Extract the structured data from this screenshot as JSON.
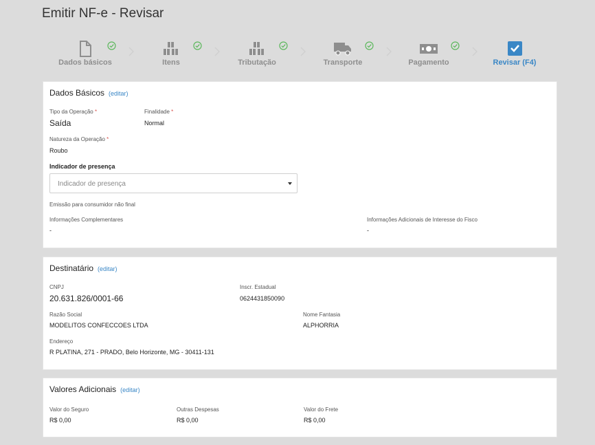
{
  "page": {
    "title": "Emitir NF-e - Revisar"
  },
  "stepper": {
    "steps": [
      {
        "label": "Dados básicos",
        "icon": "document-icon",
        "done": true
      },
      {
        "label": "Itens",
        "icon": "boxes-icon",
        "done": true
      },
      {
        "label": "Tributação",
        "icon": "boxes-icon",
        "done": true
      },
      {
        "label": "Transporte",
        "icon": "truck-icon",
        "done": true
      },
      {
        "label": "Pagamento",
        "icon": "banknote-icon",
        "done": true
      },
      {
        "label": "Revisar (F4)",
        "icon": "checkbox-icon",
        "done": false,
        "active": true
      }
    ],
    "colors": {
      "done_check": "#5cb85c",
      "active": "#3a87c6",
      "inactive": "#8e8e8e"
    }
  },
  "dados_basicos": {
    "title": "Dados Básicos",
    "edit": "(editar)",
    "tipo_operacao": {
      "label": "Tipo da Operação",
      "value": "Saída"
    },
    "finalidade": {
      "label": "Finalidade",
      "value": "Normal"
    },
    "natureza_operacao": {
      "label": "Natureza da Operação",
      "value": "Roubo"
    },
    "indicador_presenca": {
      "label": "Indicador de presença",
      "placeholder": "Indicador de presença"
    },
    "consumidor": "Emissão para consumidor não final",
    "info_complementares": {
      "label": "Informações Complementares",
      "value": "-"
    },
    "info_fisco": {
      "label": "Informações Adicionais de Interesse do Fisco",
      "value": "-"
    }
  },
  "destinatario": {
    "title": "Destinatário",
    "edit": "(editar)",
    "cnpj": {
      "label": "CNPJ",
      "value": "20.631.826/0001-66"
    },
    "inscr_estadual": {
      "label": "Inscr. Estadual",
      "value": "0624431850090"
    },
    "razao_social": {
      "label": "Razão Social",
      "value": "MODELITOS CONFECCOES LTDA"
    },
    "nome_fantasia": {
      "label": "Nome Fantasia",
      "value": "ALPHORRIA"
    },
    "endereco": {
      "label": "Endereço",
      "value": "R PLATINA, 271 - PRADO, Belo Horizonte, MG - 30411-131"
    }
  },
  "valores_adicionais": {
    "title": "Valores Adicionais",
    "edit": "(editar)",
    "seguro": {
      "label": "Valor do Seguro",
      "value": "R$ 0,00"
    },
    "outras": {
      "label": "Outras Despesas",
      "value": "R$ 0,00"
    },
    "frete": {
      "label": "Valor do Frete",
      "value": "R$ 0,00"
    }
  }
}
